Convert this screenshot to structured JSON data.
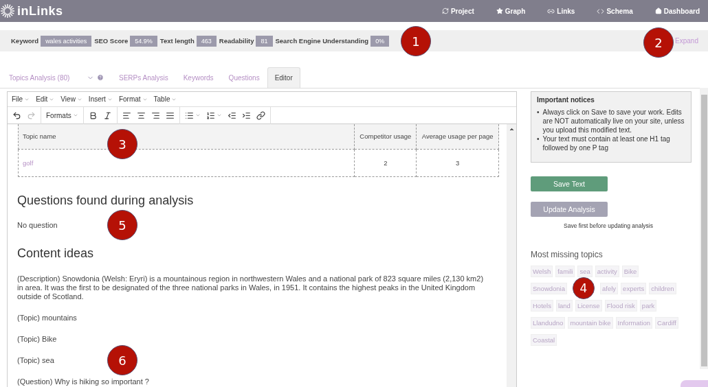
{
  "nav": {
    "logo": "inLinks",
    "links": [
      {
        "kind": "project",
        "label": "Project"
      },
      {
        "kind": "graph",
        "label": "Graph"
      },
      {
        "kind": "links",
        "label": "Links"
      },
      {
        "kind": "schema",
        "label": "Schema"
      },
      {
        "kind": "dashboard",
        "label": "Dashboard"
      }
    ]
  },
  "stats": [
    {
      "label": "Keyword",
      "value": "wales activities"
    },
    {
      "label": "SEO Score",
      "value": "54.9%"
    },
    {
      "label": "Text length",
      "value": "463"
    },
    {
      "label": "Readability",
      "value": "81"
    },
    {
      "label": "Search Engine Understanding",
      "value": "0%"
    }
  ],
  "expand": "Expand",
  "tabs": [
    {
      "label": "Topics Analysis (80)",
      "selected": false,
      "kind": "dropdown"
    },
    {
      "label": "SERPs Analysis",
      "selected": false,
      "kind": "plain"
    },
    {
      "label": "Keywords",
      "selected": false,
      "kind": "plain"
    },
    {
      "label": "Questions",
      "selected": false,
      "kind": "plain"
    },
    {
      "label": "Editor",
      "selected": true,
      "kind": "plain"
    }
  ],
  "editor": {
    "menus": [
      "File",
      "Edit",
      "View",
      "Insert",
      "Format",
      "Table"
    ],
    "toolbar": [
      {
        "kind": "undo",
        "disabled": false
      },
      {
        "kind": "redo",
        "disabled": true
      },
      {
        "kind": "formats",
        "label": "Formats",
        "disabled": false
      },
      {
        "kind": "bold",
        "disabled": false
      },
      {
        "kind": "italic",
        "disabled": false
      },
      {
        "kind": "align-left",
        "disabled": false
      },
      {
        "kind": "align-center",
        "disabled": false
      },
      {
        "kind": "align-right",
        "disabled": false
      },
      {
        "kind": "align-justify",
        "disabled": false
      },
      {
        "kind": "bullet-list",
        "disabled": false
      },
      {
        "kind": "numbered-list",
        "disabled": false
      },
      {
        "kind": "outdent",
        "disabled": false
      },
      {
        "kind": "indent",
        "disabled": false
      },
      {
        "kind": "link",
        "disabled": false
      }
    ],
    "table": {
      "columns": [
        "Topic name",
        "Competitor usage",
        "Average usage per page"
      ],
      "rows": [
        [
          "golf",
          "2",
          "3"
        ]
      ]
    },
    "content": [
      {
        "kind": "heading",
        "text": "Questions found during analysis"
      },
      {
        "kind": "paragraph",
        "text": "No question"
      },
      {
        "kind": "heading",
        "text": "Content ideas"
      },
      {
        "kind": "paragraph",
        "text": "(Description) Snowdonia (Welsh: Eryri) is a mountainous region in northwestern Wales and a national park of 823 square miles (2,130 km2) in area. It was the first to be designated of the three national parks in Wales, in 1951. It contains the highest peaks in the United Kingdom outside of Scotland."
      },
      {
        "kind": "paragraph",
        "text": "(Topic) mountains"
      },
      {
        "kind": "paragraph",
        "text": "(Topic) Bike"
      },
      {
        "kind": "paragraph",
        "text": "(Topic) sea"
      },
      {
        "kind": "paragraph",
        "text": "(Question) Why is hiking so important ?"
      }
    ]
  },
  "sidebar": {
    "notices": {
      "title": "Important notices",
      "items": [
        {
          "marker": "•",
          "text": "Always click on Save to save your work. Edits are NOT automatically live on your site, unless you upload this modified text."
        },
        {
          "marker": "•",
          "text": "Your text must contain at least one H1 tag followed by one P tag"
        }
      ]
    },
    "buttons": [
      {
        "kind": "save",
        "label": "Save Text"
      },
      {
        "kind": "update",
        "label": "Update Analysis"
      }
    ],
    "note": "Save first before updating analysis",
    "missing_title": "Most missing topics",
    "tag_rows": [
      [
        {
          "kind": "tag",
          "label": "Welsh"
        },
        {
          "kind": "tag",
          "label": "famili"
        },
        {
          "kind": "tag",
          "label": "sea"
        },
        {
          "kind": "tag",
          "label": "activity"
        },
        {
          "kind": "tag",
          "label": "Bike"
        }
      ],
      [
        {
          "kind": "tag",
          "label": "Snowdonia"
        },
        {
          "kind": "callout",
          "label": "4"
        },
        {
          "kind": "tag",
          "label": "afely"
        },
        {
          "kind": "tag",
          "label": "experts"
        },
        {
          "kind": "tag",
          "label": "children"
        }
      ],
      [
        {
          "kind": "tag",
          "label": "Hotels"
        },
        {
          "kind": "tag",
          "label": "land"
        },
        {
          "kind": "tag",
          "label": "License"
        },
        {
          "kind": "tag",
          "label": "Flood risk"
        },
        {
          "kind": "tag",
          "label": "park"
        }
      ],
      [
        {
          "kind": "tag",
          "label": "Llandudno"
        },
        {
          "kind": "tag",
          "label": "mountain bike"
        },
        {
          "kind": "tag",
          "label": "Information"
        },
        {
          "kind": "tag",
          "label": "Cardiff"
        }
      ],
      [
        {
          "kind": "tag",
          "label": "Coastal"
        }
      ]
    ]
  },
  "callouts": [
    "1",
    "2",
    "3",
    "5",
    "6"
  ]
}
